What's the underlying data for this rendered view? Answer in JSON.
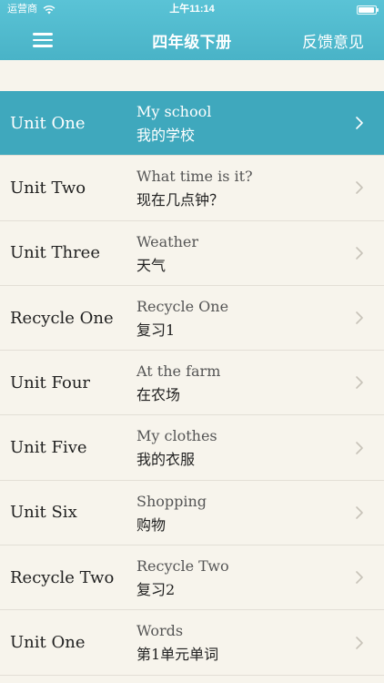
{
  "status_bar": {
    "carrier": "运营商",
    "time": "上午11:14",
    "wifi_icon": "wifi-icon",
    "battery_icon": "battery-icon"
  },
  "nav": {
    "title": "四年级下册",
    "feedback_label": "反馈意见",
    "menu_icon": "hamburger-menu-icon"
  },
  "theme": {
    "nav_bg": "#49b3c7",
    "selected_bg": "#3fa8bd",
    "page_bg": "#f7f4ec"
  },
  "list": {
    "selected_index": 0,
    "items": [
      {
        "title": "Unit One",
        "sub_en": "My school",
        "sub_cn": "我的学校"
      },
      {
        "title": "Unit Two",
        "sub_en": "What time is it?",
        "sub_cn": "现在几点钟？"
      },
      {
        "title": "Unit Three",
        "sub_en": "Weather",
        "sub_cn": "天气"
      },
      {
        "title": "Recycle One",
        "sub_en": "Recycle One",
        "sub_cn": "复习1"
      },
      {
        "title": "Unit Four",
        "sub_en": "At the farm",
        "sub_cn": "在农场"
      },
      {
        "title": "Unit Five",
        "sub_en": "My clothes",
        "sub_cn": "我的衣服"
      },
      {
        "title": "Unit Six",
        "sub_en": "Shopping",
        "sub_cn": "购物"
      },
      {
        "title": "Recycle Two",
        "sub_en": "Recycle Two",
        "sub_cn": "复习2"
      },
      {
        "title": "Unit One",
        "sub_en": "Words",
        "sub_cn": "第1单元单词"
      }
    ]
  }
}
